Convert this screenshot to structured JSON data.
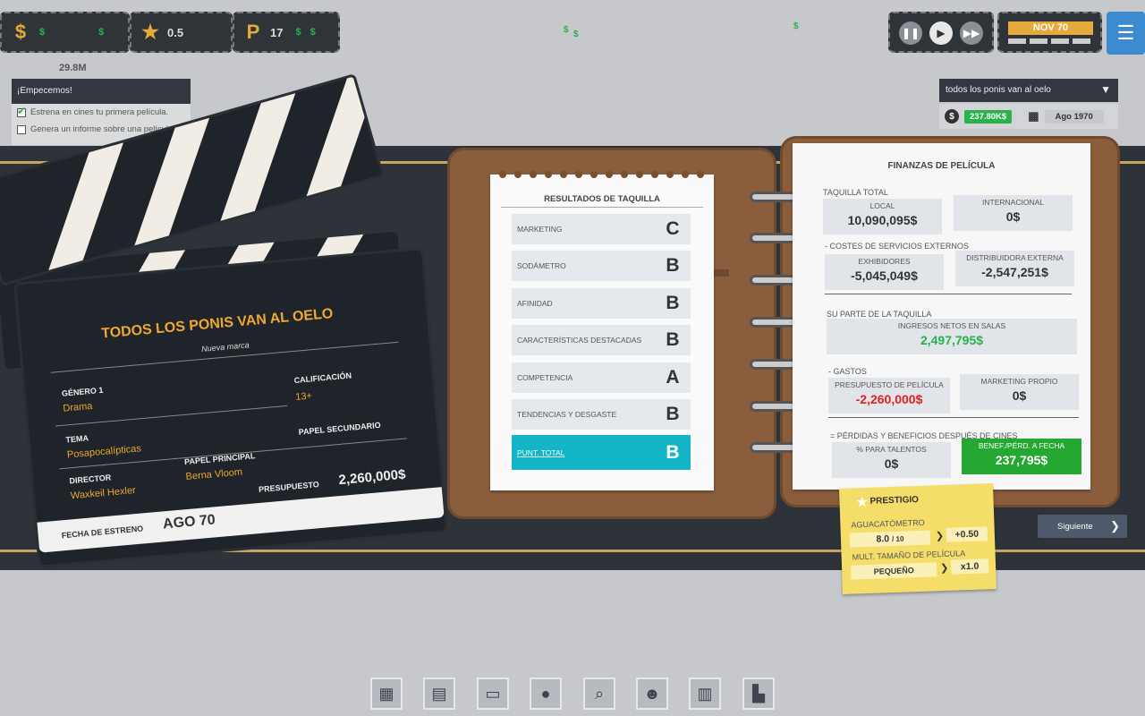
{
  "hud": {
    "money_icon": "dollar-coin-icon",
    "money_value": "29.8M",
    "star_value": "0.5",
    "research_value": "17",
    "dollar_sign": "$",
    "date_label": "NOV 70",
    "menu_icon": "hamburger-menu-icon"
  },
  "quest": {
    "title": "¡Empecemos!",
    "items": [
      {
        "label": "Estrena en cines tu primera película.",
        "done": true
      },
      {
        "label": "Genera un informe sobre una película",
        "done": false
      }
    ]
  },
  "film_info": {
    "selected": "todos los ponis van al  oelo",
    "money": "237.80K$",
    "date": "Ago 1970"
  },
  "clapboard": {
    "title": "TODOS LOS PONIS VAN AL  OELO",
    "subtitle": "Nueva marca",
    "genre_label": "GÉNERO 1",
    "genre_value": "Drama",
    "rating_label": "CALIFICACIÓN",
    "rating_value": "13+",
    "theme_label": "TEMA",
    "theme_value": "Posapocalípticas",
    "director_label": "DIRECTOR",
    "director_value": "Waxkeil Hexler",
    "lead_label": "PAPEL PRINCIPAL",
    "lead_value": "Berna Vloom",
    "support_label": "PAPEL SECUNDARIO",
    "budget_label": "PRESUPUESTO",
    "budget_value": "2,260,000$",
    "release_label": "FECHA DE ESTRENO",
    "release_value": "AGO 70"
  },
  "box_office": {
    "title": "RESULTADOS DE TAQUILLA",
    "rows": [
      {
        "label": "MARKETING",
        "grade": "C"
      },
      {
        "label": "SODÁMETRO",
        "grade": "B"
      },
      {
        "label": "AFINIDAD",
        "grade": "B"
      },
      {
        "label": "CARACTERÍSTICAS DESTACADAS",
        "grade": "B"
      },
      {
        "label": "COMPETENCIA",
        "grade": "A"
      },
      {
        "label": "TENDENCIAS Y DESGASTE",
        "grade": "B"
      }
    ],
    "total_label": "PUNT. TOTAL",
    "total_grade": "B"
  },
  "finances": {
    "title": "FINANZAS DE PELÍCULA",
    "box_office_total": "TAQUILLA TOTAL",
    "local_label": "LOCAL",
    "local_value": "10,090,095$",
    "intl_label": "INTERNACIONAL",
    "intl_value": "0$",
    "ext_costs": "- COSTES DE SERVICIOS EXTERNOS",
    "exhib_label": "EXHIBIDORES",
    "exhib_value": "-5,045,049$",
    "dist_label": "DISTRIBUIDORA EXTERNA",
    "dist_value": "-2,547,251$",
    "share_label": "SU PARTE DE LA TAQUILLA",
    "net_label": "INGRESOS NETOS EN SALAS",
    "net_value": "2,497,795$",
    "expenses_label": "- GASTOS",
    "budget_label": "PRESUPUESTO DE PELÍCULA",
    "budget_value": "-2,260,000$",
    "mkt_label": "MARKETING PROPIO",
    "mkt_value": "0$",
    "after_label": "= PÉRDIDAS Y BENEFICIOS DESPUÉS DE CINES",
    "talent_label": "% PARA TALENTOS",
    "talent_value": "0$",
    "profit_label": "BENEF./PÉRD. A FECHA",
    "profit_value": "237,795$"
  },
  "prestige": {
    "title": "PRESTIGIO",
    "aguacate_label": "AGUACATÓMETRO",
    "aguacate_value": "8.0",
    "aguacate_max": "/ 10",
    "aguacate_bonus": "+0.50",
    "size_label": "MULT. TAMAÑO DE PELÍCULA",
    "size_value": "PEQUEÑO",
    "size_mult": "x1.0"
  },
  "next_button": "Siguiente",
  "bottom_icons": [
    "film-studio-icon",
    "folder-icon",
    "tv-icon",
    "lightbulb-icon",
    "search-icon",
    "people-icon",
    "chart-icon",
    "building-icon"
  ]
}
